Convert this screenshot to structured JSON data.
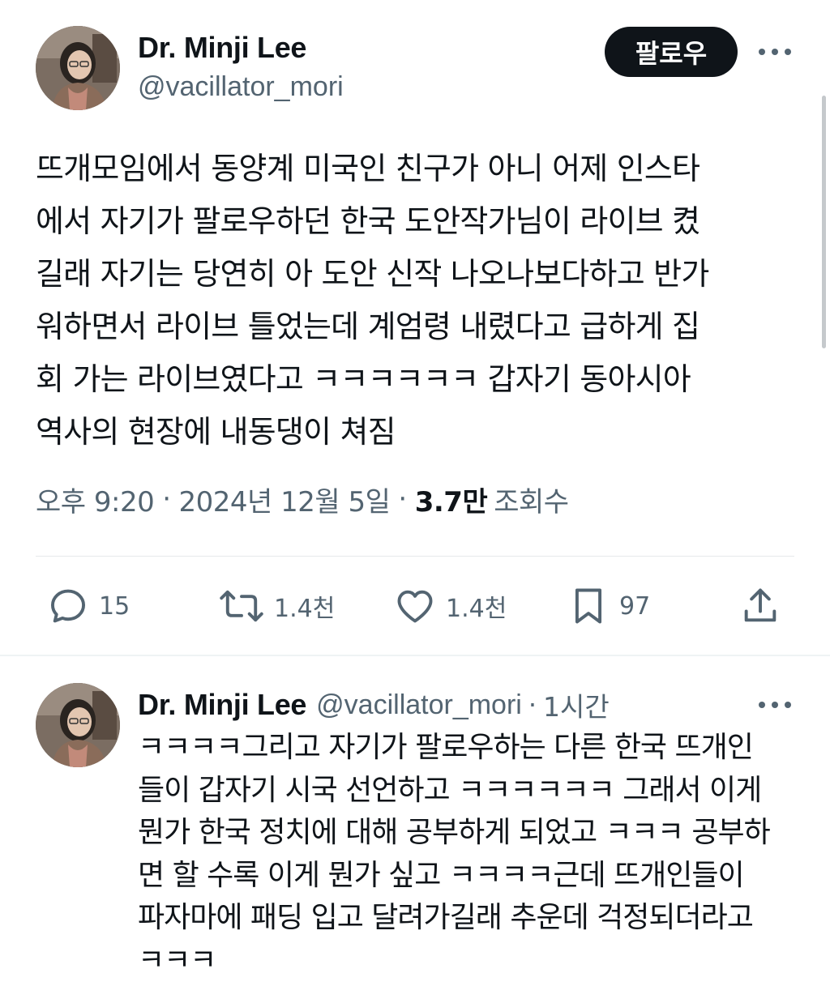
{
  "tweet": {
    "author_name": "Dr. Minji Lee",
    "author_handle": "@vacillator_mori",
    "follow_label": "팔로우",
    "more_icon": "more-horizontal-icon",
    "text": "뜨개모임에서 동양계 미국인 친구가 아니 어제 인스타\n에서 자기가 팔로우하던 한국 도안작가님이 라이브 켰\n길래 자기는 당연히 아 도안 신작 나오나보다하고 반가\n워하면서 라이브 틀었는데 계엄령 내렸다고 급하게 집\n회 가는 라이브였다고 ㅋㅋㅋㅋㅋㅋ 갑자기 동아시아\n역사의 현장에 내동댕이 쳐짐",
    "time": "오후 9:20",
    "date": "2024년 12월 5일",
    "views_count": "3.7만",
    "views_label": "조회수",
    "separator": "·"
  },
  "actions": {
    "reply": {
      "icon": "reply-icon",
      "count": "15"
    },
    "retweet": {
      "icon": "retweet-icon",
      "count": "1.4천"
    },
    "like": {
      "icon": "heart-icon",
      "count": "1.4천"
    },
    "bookmark": {
      "icon": "bookmark-icon",
      "count": "97"
    },
    "share": {
      "icon": "share-icon"
    }
  },
  "reply_tweet": {
    "author_name": "Dr. Minji Lee",
    "author_handle": "@vacillator_mori",
    "separator": "·",
    "time_ago": "1시간",
    "more_icon": "more-horizontal-icon",
    "text": "ㅋㅋㅋㅋ그리고 자기가 팔로우하는 다른 한국 뜨개인\n들이 갑자기 시국 선언하고 ㅋㅋㅋㅋㅋㅋ 그래서 이게\n뭔가 한국 정치에 대해 공부하게 되었고 ㅋㅋㅋ 공부하\n면 할 수록 이게 뭔가 싶고 ㅋㅋㅋㅋ근데 뜨개인들이\n파자마에 패딩 입고 달려가길래 추운데 걱정되더라고\nㅋㅋㅋ"
  },
  "colors": {
    "text_primary": "#0f1419",
    "text_secondary": "#536471",
    "follow_button_bg": "#0f1419",
    "divider": "#e6e9eb"
  }
}
